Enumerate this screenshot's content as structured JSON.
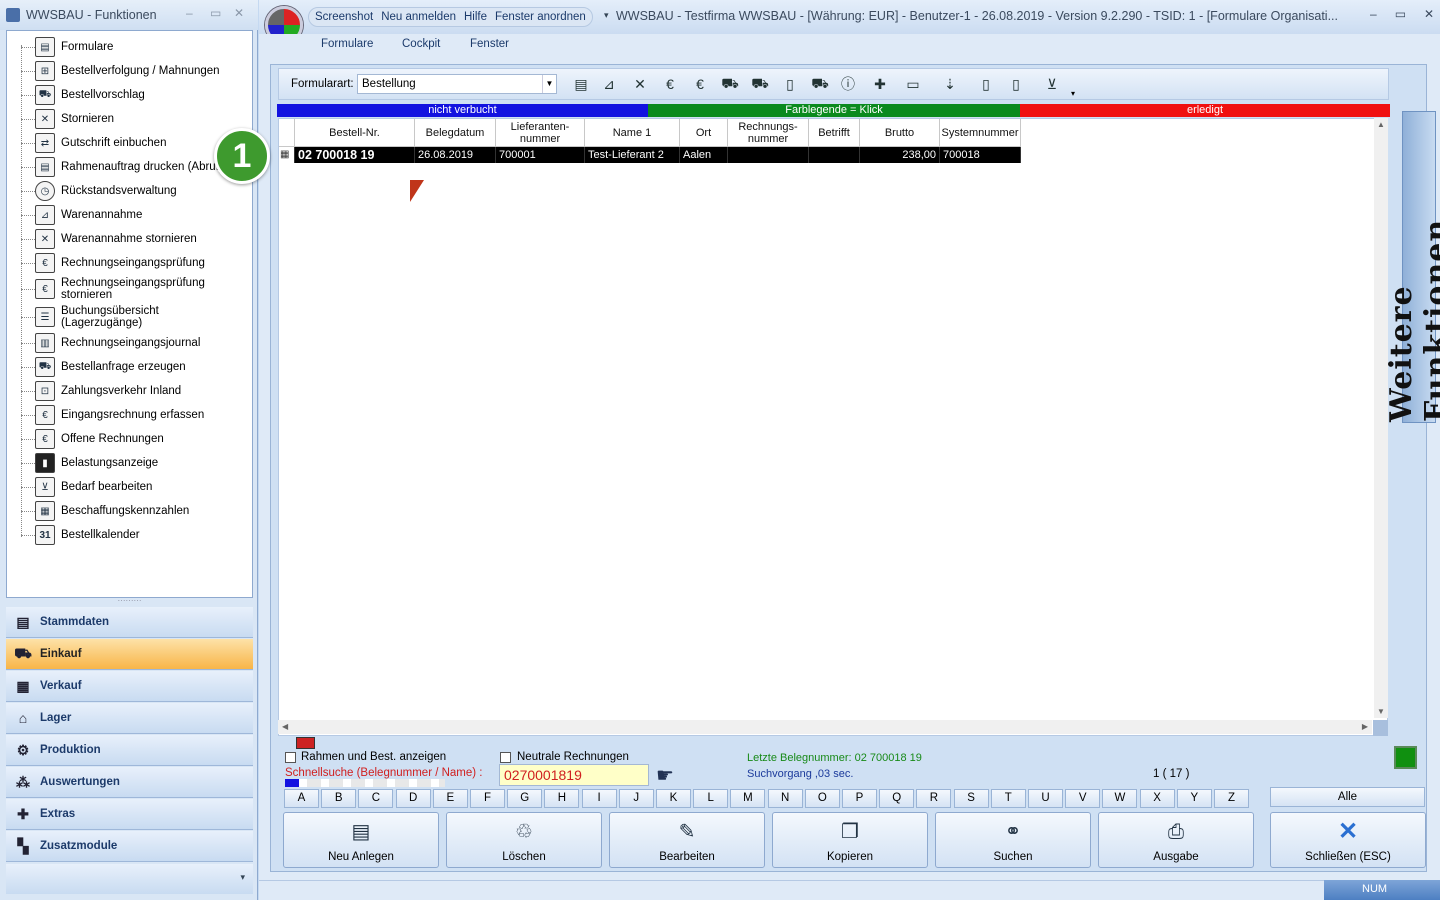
{
  "left": {
    "title": "WWSBAU - Funktionen",
    "tree_items": [
      "Formulare",
      "Bestellverfolgung / Mahnungen",
      "Bestellvorschlag",
      "Stornieren",
      "Gutschrift einbuchen",
      "Rahmenauftrag drucken (Abruf)",
      "Rückstandsverwaltung",
      "Warenannahme",
      "Warenannahme stornieren",
      "Rechnungseingangsprüfung",
      "Rechnungseingangsprüfung stornieren",
      "Buchungsübersicht (Lagerzugänge)",
      "Rechnungseingangsjournal",
      "Bestellanfrage erzeugen",
      "Zahlungsverkehr Inland",
      "Eingangsrechnung erfassen",
      "Offene Rechnungen",
      "Belastungsanzeige",
      "Bedarf bearbeiten",
      "Beschaffungskennzahlen",
      "Bestellkalender"
    ],
    "calendar_icon_text": "31",
    "categories": [
      "Stammdaten",
      "Einkauf",
      "Verkauf",
      "Lager",
      "Produktion",
      "Auswertungen",
      "Extras",
      "Zusatzmodule"
    ],
    "active_category": "Einkauf"
  },
  "qat": [
    "Screenshot",
    "Neu anmelden",
    "Hilfe",
    "Fenster anordnen"
  ],
  "window_title": "WWSBAU - Testfirma WWSBAU - [Währung: EUR] - Benutzer-1 - 26.08.2019 - Version 9.2.290  - TSID: 1  - [Formulare Organisati...",
  "menu": [
    "Formulare",
    "Cockpit",
    "Fenster"
  ],
  "toolbar": {
    "formularart_label": "Formularart:",
    "formularart_value": "Bestellung"
  },
  "legend": {
    "left": "nicht verbucht",
    "middle": "Farblegende = Klick",
    "right": "erledigt",
    "colors": {
      "left": "#1212e0",
      "middle": "#0a8a1e",
      "right": "#f01010"
    }
  },
  "grid": {
    "columns": [
      "Bestell-Nr.",
      "Belegdatum",
      "Lieferanten-nummer",
      "Name 1",
      "Ort",
      "Rechnungs-nummer",
      "Betrifft",
      "Brutto",
      "Systemnummer"
    ],
    "rows": [
      [
        "02 700018 19",
        "26.08.2019",
        "700001",
        "Test-Lieferant 2",
        "Aalen",
        "",
        "",
        "238,00",
        "700018"
      ]
    ]
  },
  "side_tab": "Weitere Funktionen",
  "bottom": {
    "chk_rahmen": "Rahmen und Best. anzeigen",
    "chk_neutral": "Neutrale Rechnungen",
    "schnellsuche_label": "Schnellsuche (Belegnummer / Name) :",
    "schnellsuche_value": "0270001819",
    "letzte_belegnummer": "Letzte Belegnummer: 02 700018 19",
    "suchvorgang": "Suchvorgang ,03 sec.",
    "count": "1  ( 17 )",
    "alphabet": [
      "A",
      "B",
      "C",
      "D",
      "E",
      "F",
      "G",
      "H",
      "I",
      "J",
      "K",
      "L",
      "M",
      "N",
      "O",
      "P",
      "Q",
      "R",
      "S",
      "T",
      "U",
      "V",
      "W",
      "X",
      "Y",
      "Z"
    ],
    "alle": "Alle",
    "buttons": [
      "Neu Anlegen",
      "Löschen",
      "Bearbeiten",
      "Kopieren",
      "Suchen",
      "Ausgabe",
      "Schließen (ESC)"
    ]
  },
  "status": {
    "num": "NUM"
  },
  "badge": "1"
}
